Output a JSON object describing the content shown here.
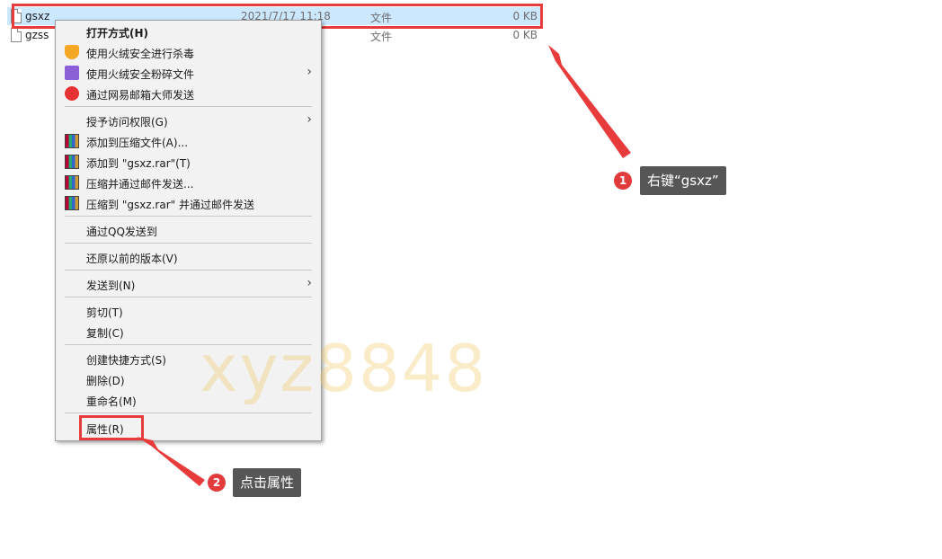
{
  "files": [
    {
      "name": "gsxz",
      "date": "2021/7/17 11:18",
      "type": "文件",
      "size": "0 KB",
      "selected": true
    },
    {
      "name": "gzss",
      "date": "",
      "type": "文件",
      "size": "0 KB",
      "selected": false
    }
  ],
  "menu": {
    "items": [
      {
        "label": "打开方式(H)",
        "icon": "none",
        "bold": true
      },
      {
        "label": "使用火绒安全进行杀毒",
        "icon": "shield-icon"
      },
      {
        "label": "使用火绒安全粉碎文件",
        "icon": "shred-icon",
        "submenu": true
      },
      {
        "label": "通过网易邮箱大师发送",
        "icon": "mail-icon"
      },
      {
        "label": "授予访问权限(G)",
        "icon": "none",
        "submenu": true
      },
      {
        "label": "添加到压缩文件(A)...",
        "icon": "winrar-icon"
      },
      {
        "label": "添加到 \"gsxz.rar\"(T)",
        "icon": "winrar-icon"
      },
      {
        "label": "压缩并通过邮件发送...",
        "icon": "winrar-icon"
      },
      {
        "label": "压缩到 \"gsxz.rar\" 并通过邮件发送",
        "icon": "winrar-icon"
      },
      {
        "label": "通过QQ发送到",
        "icon": "none"
      },
      {
        "label": "还原以前的版本(V)",
        "icon": "none"
      },
      {
        "label": "发送到(N)",
        "icon": "none",
        "submenu": true
      },
      {
        "label": "剪切(T)",
        "icon": "none"
      },
      {
        "label": "复制(C)",
        "icon": "none"
      },
      {
        "label": "创建快捷方式(S)",
        "icon": "none"
      },
      {
        "label": "删除(D)",
        "icon": "none"
      },
      {
        "label": "重命名(M)",
        "icon": "none"
      },
      {
        "label": "属性(R)",
        "icon": "none",
        "highlighted": true
      }
    ]
  },
  "annotations": {
    "step1": {
      "number": "1",
      "text": "右键“gsxz”"
    },
    "step2": {
      "number": "2",
      "text": "点击属性"
    }
  },
  "watermark": "xyz8848",
  "colors": {
    "selection": "#cce8ff",
    "highlight_red": "#e83b3b",
    "callout_bg": "#565656",
    "menu_bg": "#f2f2f2"
  }
}
